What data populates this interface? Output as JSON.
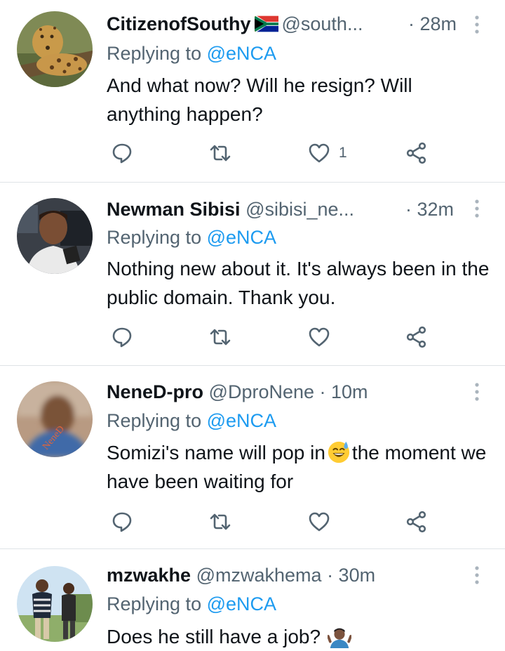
{
  "tweets": [
    {
      "name": "CitizenofSouthy",
      "handle": "@south...",
      "time": "· 28m",
      "reply_prefix": "Replying to",
      "reply_to": "@eNCA",
      "text": "And what now? Will he resign? Will anything happen?",
      "like_count": "1",
      "avatar_icon": "leopard-avatar",
      "badge_icon": "south-africa-flag"
    },
    {
      "name": "Newman Sibisi",
      "handle": "@sibisi_ne...",
      "time": "· 32m",
      "reply_prefix": "Replying to",
      "reply_to": "@eNCA",
      "text": "Nothing new about it. It's always been in the public domain. Thank you.",
      "like_count": "",
      "avatar_icon": "man-avatar"
    },
    {
      "name": "NeneD-pro",
      "handle": "@DproNene",
      "time": "· 10m",
      "reply_prefix": "Replying to",
      "reply_to": "@eNCA",
      "text_before": "Somizi's name will pop in",
      "text_after": "the moment we have been waiting for",
      "like_count": "",
      "avatar_icon": "blurred-avatar",
      "emoji": "sweat-smile-emoji"
    },
    {
      "name": "mzwakhe",
      "handle": "@mzwakhema",
      "time": "· 30m",
      "reply_prefix": "Replying to",
      "reply_to": "@eNCA",
      "text": "Does he still have a job?",
      "avatar_icon": "couple-avatar",
      "emoji": "man-shrugging-emoji"
    }
  ],
  "colors": {
    "text": "#0f1419",
    "secondary": "#536471",
    "accent": "#1d9bf0",
    "divider": "#dfe3e6"
  }
}
